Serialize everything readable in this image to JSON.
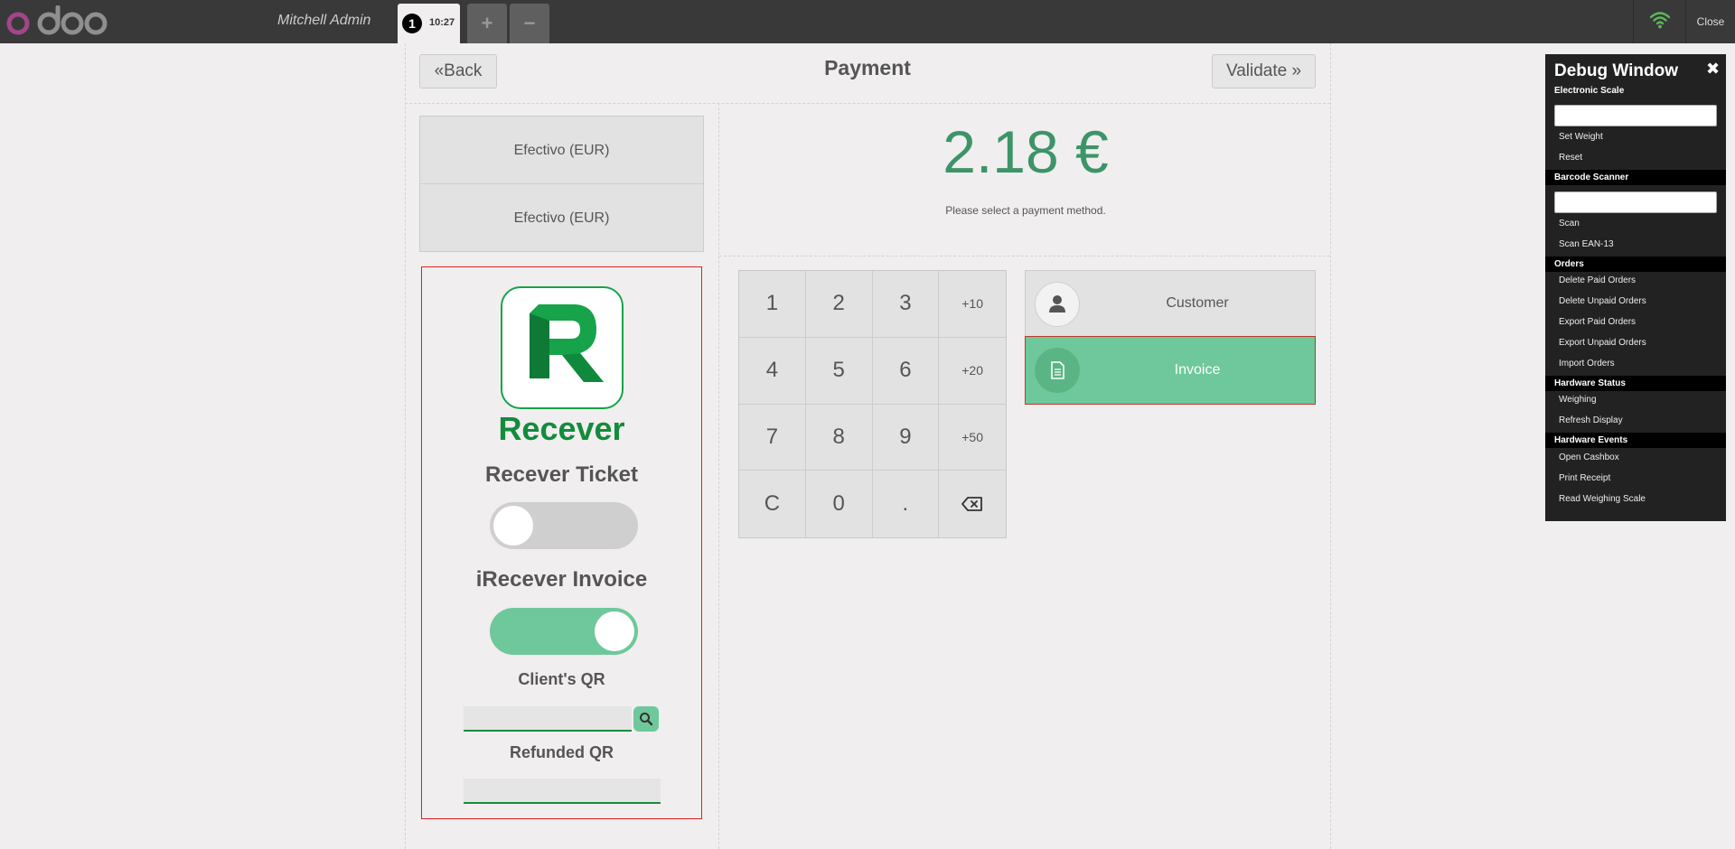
{
  "topbar": {
    "username": "Mitchell Admin",
    "order_number": "1",
    "order_time": "10:27",
    "add_label": "+",
    "remove_label": "−",
    "close_label": "Close",
    "wifi_color": "#5cb85c"
  },
  "header": {
    "back_label": "Back",
    "title": "Payment",
    "validate_label": "Validate"
  },
  "payment_methods": [
    "Efectivo (EUR)",
    "Efectivo (EUR)"
  ],
  "recever": {
    "brand": "Recever",
    "ticket_label": "Recever Ticket",
    "ticket_enabled": false,
    "invoice_label": "iRecever Invoice",
    "invoice_enabled": true,
    "client_qr_label": "Client's QR",
    "client_qr_value": "",
    "refunded_qr_label": "Refunded QR",
    "refunded_qr_value": "",
    "brand_color": "#128c3c"
  },
  "summary": {
    "amount": "2.18 €",
    "hint": "Please select a payment method."
  },
  "numpad": [
    "1",
    "2",
    "3",
    "+10",
    "4",
    "5",
    "6",
    "+20",
    "7",
    "8",
    "9",
    "+50",
    "C",
    "0",
    ".",
    "backspace"
  ],
  "actions": {
    "customer_label": "Customer",
    "invoice_label": "Invoice",
    "invoice_active": true,
    "accent_color": "#6ec89b"
  },
  "debug": {
    "title": "Debug Window",
    "sections": {
      "scale": "Electronic Scale",
      "barcode": "Barcode Scanner",
      "orders": "Orders",
      "hw_status": "Hardware Status",
      "hw_events": "Hardware Events"
    },
    "scale_items": [
      "Set Weight",
      "Reset"
    ],
    "barcode_items": [
      "Scan",
      "Scan EAN-13"
    ],
    "order_items": [
      "Delete Paid Orders",
      "Delete Unpaid Orders",
      "Export Paid Orders",
      "Export Unpaid Orders",
      "Import Orders"
    ],
    "status_items": [
      "Weighing",
      "Refresh Display"
    ],
    "event_items": [
      "Open Cashbox",
      "Print Receipt",
      "Read Weighing Scale"
    ]
  }
}
